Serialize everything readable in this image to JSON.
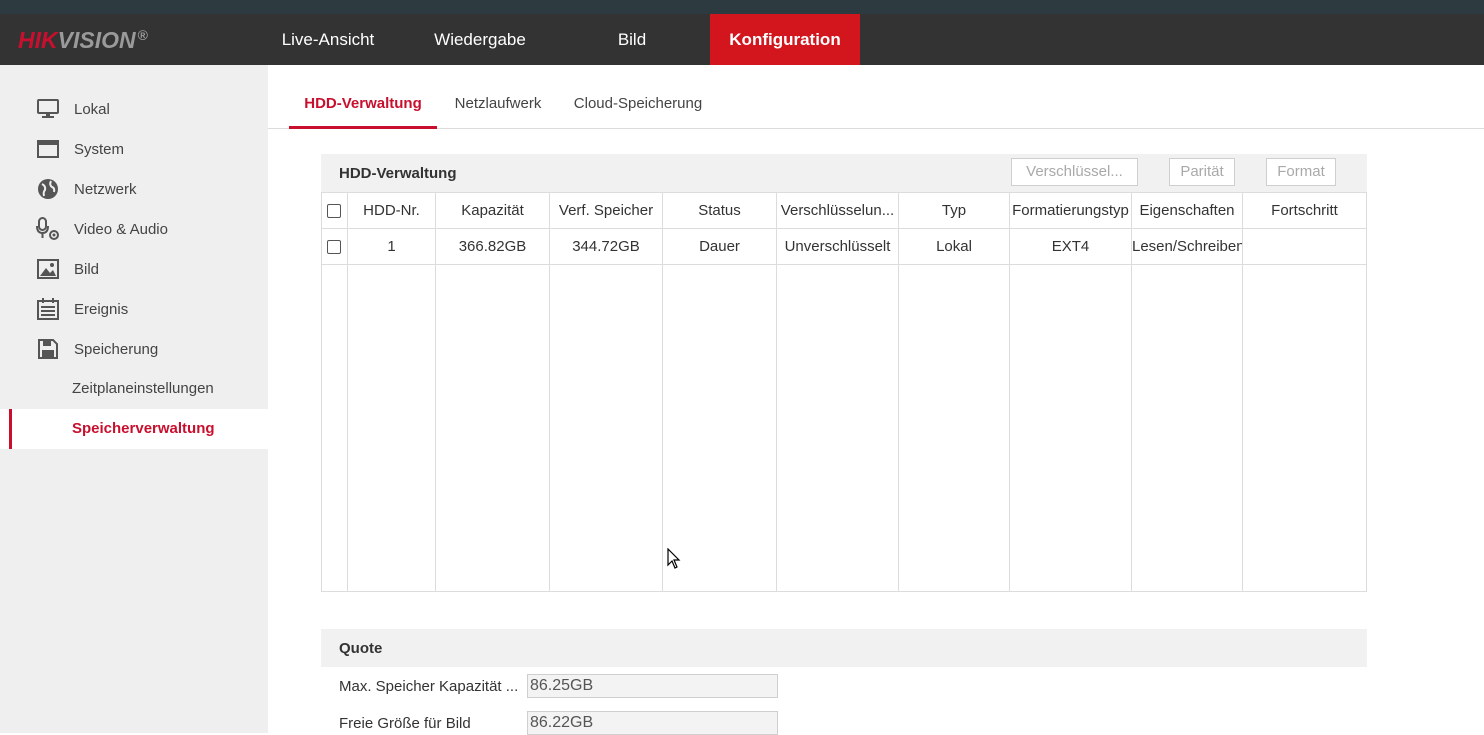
{
  "brand": {
    "name_red": "HIK",
    "name_grey": "VISION",
    "reg": "®"
  },
  "nav": [
    {
      "label": "Live-Ansicht",
      "active": false
    },
    {
      "label": "Wiedergabe",
      "active": false
    },
    {
      "label": "Bild",
      "active": false
    },
    {
      "label": "Konfiguration",
      "active": true
    }
  ],
  "sidebar": {
    "items": [
      {
        "label": "Lokal",
        "icon": "monitor-icon"
      },
      {
        "label": "System",
        "icon": "window-icon"
      },
      {
        "label": "Netzwerk",
        "icon": "globe-icon"
      },
      {
        "label": "Video & Audio",
        "icon": "microphone-camera-icon"
      },
      {
        "label": "Bild",
        "icon": "image-icon"
      },
      {
        "label": "Ereignis",
        "icon": "calendar-icon"
      },
      {
        "label": "Speicherung",
        "icon": "floppy-disk-icon"
      }
    ],
    "subitems": [
      {
        "label": "Zeitplaneinstellungen",
        "active": false
      },
      {
        "label": "Speicherverwaltung",
        "active": true
      }
    ]
  },
  "tabs": [
    {
      "label": "HDD-Verwaltung",
      "active": true
    },
    {
      "label": "Netzlaufwerk",
      "active": false
    },
    {
      "label": "Cloud-Speicherung",
      "active": false
    }
  ],
  "hdd": {
    "title": "HDD-Verwaltung",
    "buttons": {
      "encrypt": "Verschlüssel...",
      "parity": "Parität",
      "format": "Format"
    },
    "columns": [
      "HDD-Nr.",
      "Kapazität",
      "Verf. Speicher",
      "Status",
      "Verschlüsselun...",
      "Typ",
      "Formatierungstyp",
      "Eigenschaften",
      "Fortschritt"
    ],
    "rows": [
      {
        "no": "1",
        "capacity": "366.82GB",
        "free": "344.72GB",
        "status": "Dauer",
        "encryption": "Unverschlüsselt",
        "type": "Lokal",
        "format_type": "EXT4",
        "property": "Lesen/Schreiben",
        "progress": ""
      }
    ]
  },
  "quota": {
    "title": "Quote",
    "max_label": "Max. Speicher Kapazität ...",
    "max_value": "86.25GB",
    "free_label": "Freie Größe für Bild",
    "free_value": "86.22GB"
  },
  "colors": {
    "accent": "#c8102e",
    "topbar": "#333333",
    "sidebar": "#efefef"
  }
}
